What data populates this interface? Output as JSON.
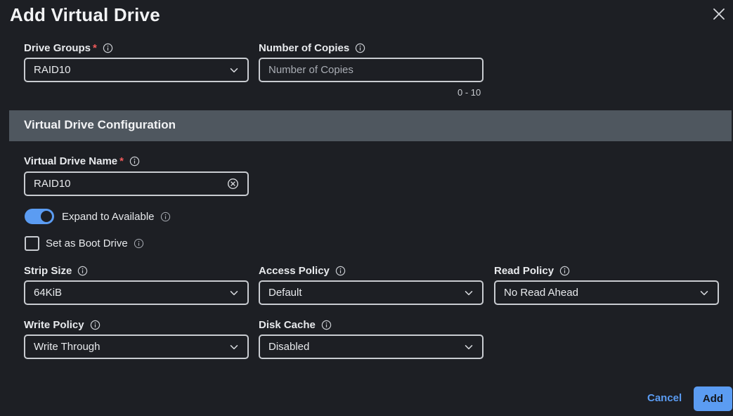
{
  "dialog": {
    "title": "Add Virtual Drive",
    "close_icon": "close-icon"
  },
  "drive_groups": {
    "label": "Drive Groups",
    "required_mark": "*",
    "value": "RAID10"
  },
  "number_of_copies": {
    "label": "Number of Copies",
    "placeholder": "Number of Copies",
    "range_hint": "0 - 10"
  },
  "section": {
    "title": "Virtual Drive Configuration"
  },
  "virtual_drive_name": {
    "label": "Virtual Drive Name",
    "required_mark": "*",
    "value": "RAID10"
  },
  "expand_to_available": {
    "label": "Expand to Available",
    "checked": true
  },
  "boot_drive": {
    "label": "Set as Boot Drive",
    "checked": false
  },
  "strip_size": {
    "label": "Strip Size",
    "value": "64KiB"
  },
  "access_policy": {
    "label": "Access Policy",
    "value": "Default"
  },
  "read_policy": {
    "label": "Read Policy",
    "value": "No Read Ahead"
  },
  "write_policy": {
    "label": "Write Policy",
    "value": "Write Through"
  },
  "disk_cache": {
    "label": "Disk Cache",
    "value": "Disabled"
  },
  "footer": {
    "cancel_label": "Cancel",
    "add_label": "Add"
  },
  "colors": {
    "background": "#1d1f24",
    "accent": "#5b9cf2",
    "section_bar": "#4f575f",
    "required": "#f05a5a"
  }
}
